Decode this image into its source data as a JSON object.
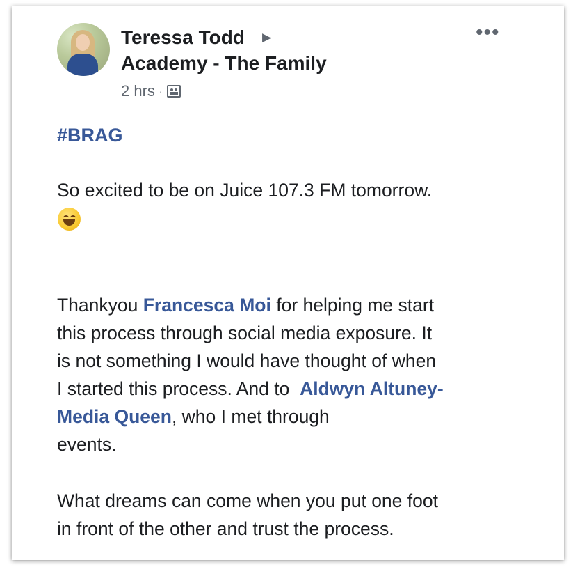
{
  "post": {
    "author": "Teressa Todd",
    "group": "Academy - The Family",
    "timestamp": "2 hrs",
    "separator": "·",
    "more_label": "•••",
    "arrow": "▶",
    "hashtag": "#BRAG",
    "paragraph1": "So excited to be on Juice 107.3 FM tomorrow.",
    "paragraph2": {
      "l1_a": "Thankyou ",
      "l1_link": "Francesca Moi",
      "l1_b": " for helping me start",
      "l2": "this process through social media exposure. It",
      "l3": "is not something I would have thought of when",
      "l4_a": "I started this process. And to  ",
      "l4_link": "Aldwyn Altuney-",
      "l5_link": "Media Queen",
      "l5_b": ", who I met through",
      "l6": "events."
    },
    "paragraph3": {
      "l1": "What dreams can come when you put one foot",
      "l2": "in front of the other and trust the process."
    }
  },
  "colors": {
    "link": "#385898",
    "text": "#1c1e21",
    "secondary": "#606770"
  },
  "icons": {
    "privacy": "group-icon",
    "emoji": "grinning-face-emoji"
  }
}
